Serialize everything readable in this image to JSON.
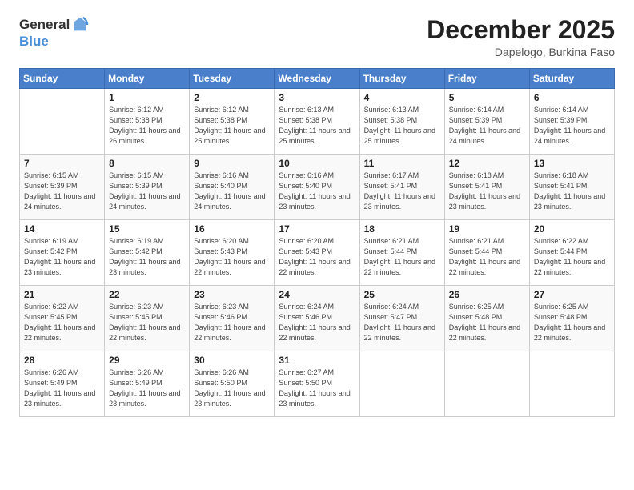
{
  "logo": {
    "general": "General",
    "blue": "Blue"
  },
  "header": {
    "month": "December 2025",
    "location": "Dapelogo, Burkina Faso"
  },
  "days_of_week": [
    "Sunday",
    "Monday",
    "Tuesday",
    "Wednesday",
    "Thursday",
    "Friday",
    "Saturday"
  ],
  "weeks": [
    [
      {
        "day": "",
        "info": ""
      },
      {
        "day": "1",
        "info": "Sunrise: 6:12 AM\nSunset: 5:38 PM\nDaylight: 11 hours\nand 26 minutes."
      },
      {
        "day": "2",
        "info": "Sunrise: 6:12 AM\nSunset: 5:38 PM\nDaylight: 11 hours\nand 25 minutes."
      },
      {
        "day": "3",
        "info": "Sunrise: 6:13 AM\nSunset: 5:38 PM\nDaylight: 11 hours\nand 25 minutes."
      },
      {
        "day": "4",
        "info": "Sunrise: 6:13 AM\nSunset: 5:38 PM\nDaylight: 11 hours\nand 25 minutes."
      },
      {
        "day": "5",
        "info": "Sunrise: 6:14 AM\nSunset: 5:39 PM\nDaylight: 11 hours\nand 24 minutes."
      },
      {
        "day": "6",
        "info": "Sunrise: 6:14 AM\nSunset: 5:39 PM\nDaylight: 11 hours\nand 24 minutes."
      }
    ],
    [
      {
        "day": "7",
        "info": ""
      },
      {
        "day": "8",
        "info": "Sunrise: 6:15 AM\nSunset: 5:39 PM\nDaylight: 11 hours\nand 24 minutes."
      },
      {
        "day": "9",
        "info": "Sunrise: 6:16 AM\nSunset: 5:40 PM\nDaylight: 11 hours\nand 24 minutes."
      },
      {
        "day": "10",
        "info": "Sunrise: 6:16 AM\nSunset: 5:40 PM\nDaylight: 11 hours\nand 23 minutes."
      },
      {
        "day": "11",
        "info": "Sunrise: 6:17 AM\nSunset: 5:41 PM\nDaylight: 11 hours\nand 23 minutes."
      },
      {
        "day": "12",
        "info": "Sunrise: 6:18 AM\nSunset: 5:41 PM\nDaylight: 11 hours\nand 23 minutes."
      },
      {
        "day": "13",
        "info": "Sunrise: 6:18 AM\nSunset: 5:41 PM\nDaylight: 11 hours\nand 23 minutes."
      }
    ],
    [
      {
        "day": "14",
        "info": ""
      },
      {
        "day": "15",
        "info": "Sunrise: 6:19 AM\nSunset: 5:42 PM\nDaylight: 11 hours\nand 23 minutes."
      },
      {
        "day": "16",
        "info": "Sunrise: 6:20 AM\nSunset: 5:43 PM\nDaylight: 11 hours\nand 22 minutes."
      },
      {
        "day": "17",
        "info": "Sunrise: 6:20 AM\nSunset: 5:43 PM\nDaylight: 11 hours\nand 22 minutes."
      },
      {
        "day": "18",
        "info": "Sunrise: 6:21 AM\nSunset: 5:44 PM\nDaylight: 11 hours\nand 22 minutes."
      },
      {
        "day": "19",
        "info": "Sunrise: 6:21 AM\nSunset: 5:44 PM\nDaylight: 11 hours\nand 22 minutes."
      },
      {
        "day": "20",
        "info": "Sunrise: 6:22 AM\nSunset: 5:44 PM\nDaylight: 11 hours\nand 22 minutes."
      }
    ],
    [
      {
        "day": "21",
        "info": ""
      },
      {
        "day": "22",
        "info": "Sunrise: 6:23 AM\nSunset: 5:45 PM\nDaylight: 11 hours\nand 22 minutes."
      },
      {
        "day": "23",
        "info": "Sunrise: 6:23 AM\nSunset: 5:46 PM\nDaylight: 11 hours\nand 22 minutes."
      },
      {
        "day": "24",
        "info": "Sunrise: 6:24 AM\nSunset: 5:46 PM\nDaylight: 11 hours\nand 22 minutes."
      },
      {
        "day": "25",
        "info": "Sunrise: 6:24 AM\nSunset: 5:47 PM\nDaylight: 11 hours\nand 22 minutes."
      },
      {
        "day": "26",
        "info": "Sunrise: 6:25 AM\nSunset: 5:48 PM\nDaylight: 11 hours\nand 22 minutes."
      },
      {
        "day": "27",
        "info": "Sunrise: 6:25 AM\nSunset: 5:48 PM\nDaylight: 11 hours\nand 22 minutes."
      }
    ],
    [
      {
        "day": "28",
        "info": "Sunrise: 6:26 AM\nSunset: 5:49 PM\nDaylight: 11 hours\nand 23 minutes."
      },
      {
        "day": "29",
        "info": "Sunrise: 6:26 AM\nSunset: 5:49 PM\nDaylight: 11 hours\nand 23 minutes."
      },
      {
        "day": "30",
        "info": "Sunrise: 6:26 AM\nSunset: 5:50 PM\nDaylight: 11 hours\nand 23 minutes."
      },
      {
        "day": "31",
        "info": "Sunrise: 6:27 AM\nSunset: 5:50 PM\nDaylight: 11 hours\nand 23 minutes."
      },
      {
        "day": "",
        "info": ""
      },
      {
        "day": "",
        "info": ""
      },
      {
        "day": "",
        "info": ""
      }
    ]
  ],
  "week1_row1_sun_info": "Sunrise: 6:15 AM\nSunset: 5:39 PM\nDaylight: 11 hours\nand 24 minutes.",
  "week3_row3_sun_info": "Sunrise: 6:19 AM\nSunset: 5:42 PM\nDaylight: 11 hours\nand 23 minutes.",
  "week4_row4_sun_info": "Sunrise: 6:22 AM\nSunset: 5:45 PM\nDaylight: 11 hours\nand 22 minutes."
}
